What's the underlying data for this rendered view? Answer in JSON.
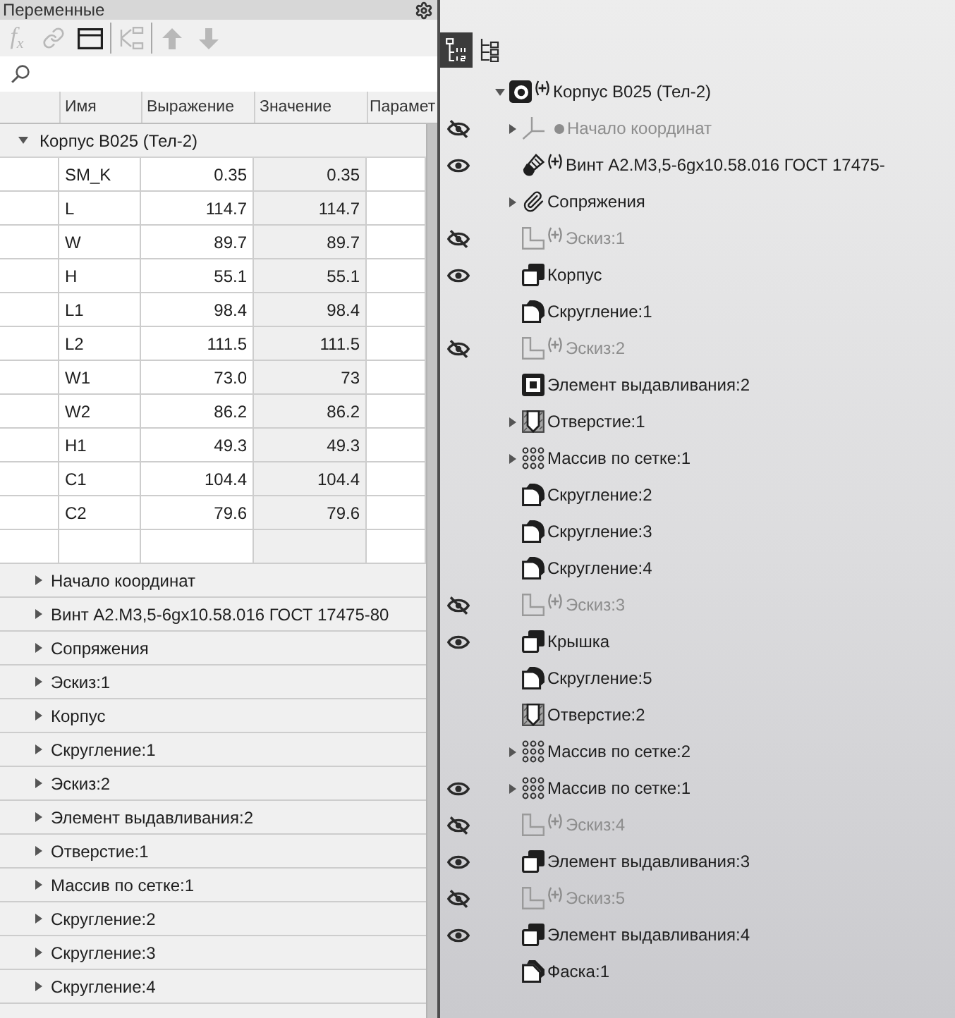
{
  "variables_panel": {
    "title": "Переменные",
    "toolbar": [
      {
        "buttons": [
          {
            "kind": "function",
            "label": "f$_{x}$",
            "disabled": true
          },
          {
            "kind": "link",
            "disabled": true
          },
          {
            "kind": "window",
            "disabled": false
          }
        ]
      },
      {
        "buttons": [
          {
            "kind": "hierarchy",
            "disabled": true
          }
        ]
      },
      {
        "buttons": [
          {
            "kind": "move_up",
            "disabled": true
          },
          {
            "kind": "move_down",
            "disabled": true
          }
        ]
      }
    ],
    "columns": [
      "Имя",
      "Выражение",
      "Значение",
      "Парамет"
    ],
    "group": {
      "label": "Корпус B025 (Тел-2)",
      "expanded": true,
      "variables": [
        {
          "name": "SM_K",
          "expression": "0.35",
          "value": "0.35"
        },
        {
          "name": "L",
          "expression": "114.7",
          "value": "114.7"
        },
        {
          "name": "W",
          "expression": "89.7",
          "value": "89.7"
        },
        {
          "name": "H",
          "expression": "55.1",
          "value": "55.1"
        },
        {
          "name": "L1",
          "expression": "98.4",
          "value": "98.4"
        },
        {
          "name": "L2",
          "expression": "111.5",
          "value": "111.5"
        },
        {
          "name": "W1",
          "expression": "73.0",
          "value": "73"
        },
        {
          "name": "W2",
          "expression": "86.2",
          "value": "86.2"
        },
        {
          "name": "H1",
          "expression": "49.3",
          "value": "49.3"
        },
        {
          "name": "C1",
          "expression": "104.4",
          "value": "104.4"
        },
        {
          "name": "C2",
          "expression": "79.6",
          "value": "79.6"
        }
      ],
      "children": [
        {
          "label": "Начало координат",
          "expanded": false
        },
        {
          "label": "Винт A2.M3,5-6gx10.58.016 ГОСТ 17475-80",
          "expanded": false
        },
        {
          "label": "Сопряжения",
          "expanded": false
        },
        {
          "label": "Эскиз:1",
          "expanded": false
        },
        {
          "label": "Корпус",
          "expanded": false
        },
        {
          "label": "Скругление:1",
          "expanded": false
        },
        {
          "label": "Эскиз:2",
          "expanded": false
        },
        {
          "label": "Элемент выдавливания:2",
          "expanded": false
        },
        {
          "label": "Отверстие:1",
          "expanded": false
        },
        {
          "label": "Массив по сетке:1",
          "expanded": false
        },
        {
          "label": "Скругление:2",
          "expanded": false
        },
        {
          "label": "Скругление:3",
          "expanded": false
        },
        {
          "label": "Скругление:4",
          "expanded": false
        }
      ]
    }
  },
  "tree_panel": {
    "view_buttons": [
      {
        "kind": "numbered_tree",
        "selected": true
      },
      {
        "kind": "tree",
        "selected": false
      }
    ],
    "root": {
      "label": "Корпус B025 (Тел-2)",
      "kind": "part",
      "plus": true,
      "expanded": true,
      "children": [
        {
          "label": "Начало координат",
          "kind": "origin",
          "visible": false,
          "expanded": false,
          "bullet": true
        },
        {
          "label": "Винт A2.M3,5-6gx10.58.016 ГОСТ 17475-",
          "kind": "bolt",
          "visible": true,
          "plus": true
        },
        {
          "label": "Сопряжения",
          "kind": "mates",
          "expanded": false
        },
        {
          "label": "Эскиз:1",
          "kind": "sketch",
          "visible": false,
          "plus": true
        },
        {
          "label": "Корпус",
          "kind": "extrude",
          "visible": true
        },
        {
          "label": "Скругление:1",
          "kind": "fillet"
        },
        {
          "label": "Эскиз:2",
          "kind": "sketch",
          "visible": false,
          "plus": true
        },
        {
          "label": "Элемент выдавливания:2",
          "kind": "cut"
        },
        {
          "label": "Отверстие:1",
          "kind": "hole",
          "expanded": false
        },
        {
          "label": "Массив по сетке:1",
          "kind": "pattern",
          "expanded": false
        },
        {
          "label": "Скругление:2",
          "kind": "fillet"
        },
        {
          "label": "Скругление:3",
          "kind": "fillet"
        },
        {
          "label": "Скругление:4",
          "kind": "fillet"
        },
        {
          "label": "Эскиз:3",
          "kind": "sketch",
          "visible": false,
          "plus": true
        },
        {
          "label": "Крышка",
          "kind": "extrude",
          "visible": true
        },
        {
          "label": "Скругление:5",
          "kind": "fillet"
        },
        {
          "label": "Отверстие:2",
          "kind": "hole"
        },
        {
          "label": "Массив по сетке:2",
          "kind": "pattern",
          "expanded": false
        },
        {
          "label": "Массив по сетке:1",
          "kind": "pattern",
          "visible": true,
          "expanded": false
        },
        {
          "label": "Эскиз:4",
          "kind": "sketch",
          "visible": false,
          "plus": true
        },
        {
          "label": "Элемент выдавливания:3",
          "kind": "extrude",
          "visible": true
        },
        {
          "label": "Эскиз:5",
          "kind": "sketch",
          "visible": false,
          "plus": true
        },
        {
          "label": "Элемент выдавливания:4",
          "kind": "extrude",
          "visible": true
        },
        {
          "label": "Фаска:1",
          "kind": "chamfer"
        }
      ]
    }
  }
}
